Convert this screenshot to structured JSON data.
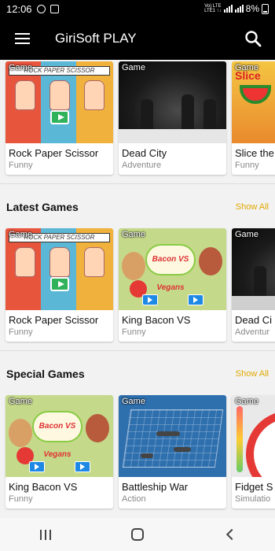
{
  "status_bar": {
    "time": "12:06",
    "network_top": "Vo) LTE",
    "network_bottom": "LTE1 ↑↓",
    "battery": "8%",
    "icons": [
      "whatsapp-icon",
      "messaging-icon",
      "signal-icon",
      "battery-icon"
    ]
  },
  "app_bar": {
    "title": "GiriSoft PLAY",
    "menu_icon": "hamburger-menu-icon",
    "search_icon": "search-icon"
  },
  "sections": [
    {
      "title": "",
      "show_all": "",
      "items": [
        {
          "badge": "Game",
          "name": "Rock Paper Scissor",
          "category": "Funny",
          "thumb": "rps"
        },
        {
          "badge": "Game",
          "name": "Dead City",
          "category": "Adventure",
          "thumb": "dead"
        },
        {
          "badge": "Game",
          "name": "Slice the",
          "category": "Funny",
          "thumb": "slice"
        }
      ]
    },
    {
      "title": "Latest Games",
      "show_all": "Show All",
      "items": [
        {
          "badge": "Game",
          "name": "Rock Paper Scissor",
          "category": "Funny",
          "thumb": "rps"
        },
        {
          "badge": "Game",
          "name": "King Bacon VS",
          "category": "Funny",
          "thumb": "bacon"
        },
        {
          "badge": "Game",
          "name": "Dead Ci",
          "category": "Adventur",
          "thumb": "dead"
        }
      ]
    },
    {
      "title": "Special Games",
      "show_all": "Show All",
      "items": [
        {
          "badge": "Game",
          "name": "King Bacon VS",
          "category": "Funny",
          "thumb": "bacon"
        },
        {
          "badge": "Game",
          "name": "Battleship War",
          "category": "Action",
          "thumb": "battle"
        },
        {
          "badge": "Game",
          "name": "Fidget S",
          "category": "Simulatio",
          "thumb": "fidget"
        }
      ]
    }
  ],
  "thumb_text": {
    "rps_title": "ROCK PAPER SCISSOR",
    "bacon_logo": "Bacon VS Vegans",
    "slice_word": "Slice"
  },
  "colors": {
    "app_bar": "#000000",
    "accent": "#e0a800",
    "background": "#f2f2f2"
  },
  "nav_bar": {
    "recent_icon": "recent-apps-icon",
    "home_icon": "home-icon",
    "back_icon": "back-icon"
  }
}
